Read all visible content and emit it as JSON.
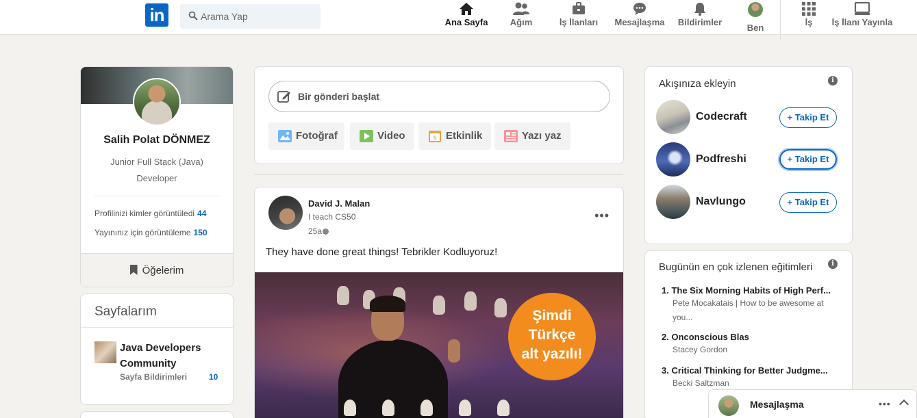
{
  "header": {
    "logo": "in",
    "search_placeholder": "Arama Yap",
    "nav": [
      {
        "label": "Ana Sayfa",
        "icon": "home-icon"
      },
      {
        "label": "Ağım",
        "icon": "network-icon"
      },
      {
        "label": "İş İlanları",
        "icon": "briefcase-icon"
      },
      {
        "label": "Mesajlaşma",
        "icon": "messaging-icon"
      },
      {
        "label": "Bildirimler",
        "icon": "bell-icon"
      },
      {
        "label": "Ben",
        "icon": "avatar"
      },
      {
        "label": "İş",
        "icon": "grid-icon"
      },
      {
        "label": "İş İlanı Yayınla",
        "icon": "post-job-icon"
      }
    ]
  },
  "profile": {
    "name": "Salih Polat DÖNMEZ",
    "title_line1": "Junior Full Stack (Java)",
    "title_line2": "Developer",
    "views_label": "Profilinizi kimler görüntüledi",
    "views_count": "44",
    "post_views_label": "Yayınınız için görüntüleme",
    "post_views_count": "150",
    "items_label": "Öğelerim"
  },
  "pages": {
    "title": "Sayfalarım",
    "page_name": "Java Developers Community",
    "notif_label": "Sayfa Bildirimleri",
    "notif_count": "10"
  },
  "share": {
    "start_post": "Bir gönderi başlat",
    "buttons": [
      "Fotoğraf",
      "Video",
      "Etkinlik",
      "Yazı yaz"
    ]
  },
  "post": {
    "author": "David J. Malan",
    "subtitle": "I teach CS50",
    "time": "25a",
    "text": "They have done great things! Tebrikler Kodluyoruz!",
    "image_badge_line1": "Şimdi",
    "image_badge_line2": "Türkçe",
    "image_badge_line3": "alt yazılı!"
  },
  "feed_suggestions": {
    "title": "Akışınıza ekleyin",
    "items": [
      {
        "name": "Codecraft",
        "button": "+ Takip Et"
      },
      {
        "name": "Podfreshi",
        "button": "+ Takip Et"
      },
      {
        "name": "Navlungo",
        "button": "+ Takip Et"
      }
    ]
  },
  "courses": {
    "title": "Bugünün en çok izlenen eğitimleri",
    "items": [
      {
        "title": "1. The Six Morning Habits of High Perf...",
        "sub": "Pete Mocakatais | How to be awesome at you..."
      },
      {
        "title": "2. Onconscious Blas",
        "sub": "Stacey Gordon"
      },
      {
        "title": "3. Critical Thinking for Better Judgme...",
        "sub": "Becki Saltzman"
      }
    ]
  },
  "messaging": {
    "label": "Mesajlaşma"
  },
  "colors": {
    "brand": "#0a66c2",
    "background": "#f3f2ef",
    "badge": "#f28c1e"
  }
}
